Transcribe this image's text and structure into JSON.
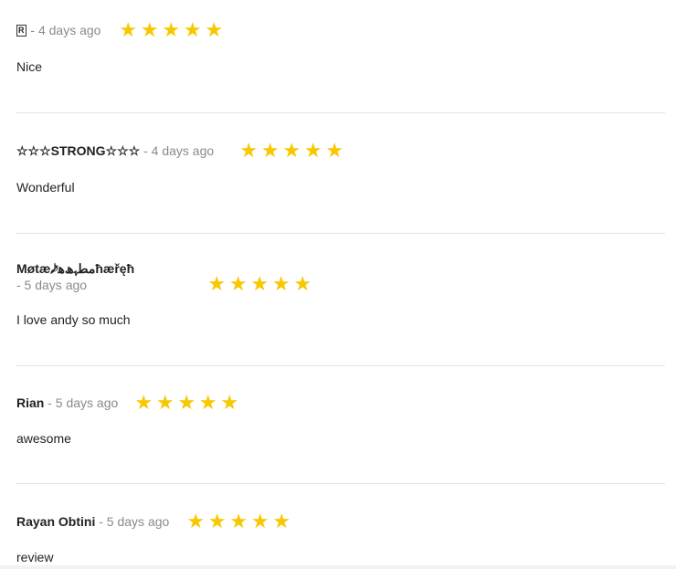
{
  "reviews": [
    {
      "author": "",
      "author_badge": "R",
      "time": " - 4 days ago",
      "rating": 5,
      "stars": "★★★★★",
      "body": "Nice"
    },
    {
      "author": "☆☆☆STRONG☆☆☆",
      "time": " - 4 days ago",
      "rating": 5,
      "stars": "★★★★★",
      "body": "Wonderful"
    },
    {
      "author": "Møtæ𝆹𝅥𝅮ﻣﻄﮩﮪﻫ̷ħæřęħ",
      "time": "- 5 days ago",
      "rating": 5,
      "stars": "★★★★★",
      "body": "I love andy so much"
    },
    {
      "author": "Rian",
      "time": " - 5 days ago",
      "rating": 5,
      "stars": "★★★★★",
      "body": "awesome"
    },
    {
      "author": "Rayan Obtini",
      "time": " - 5 days ago",
      "rating": 5,
      "stars": "★★★★★",
      "body": "review"
    }
  ],
  "colors": {
    "star": "#f7c800",
    "time": "#8a8a8a",
    "divider": "#e3e3e3"
  }
}
